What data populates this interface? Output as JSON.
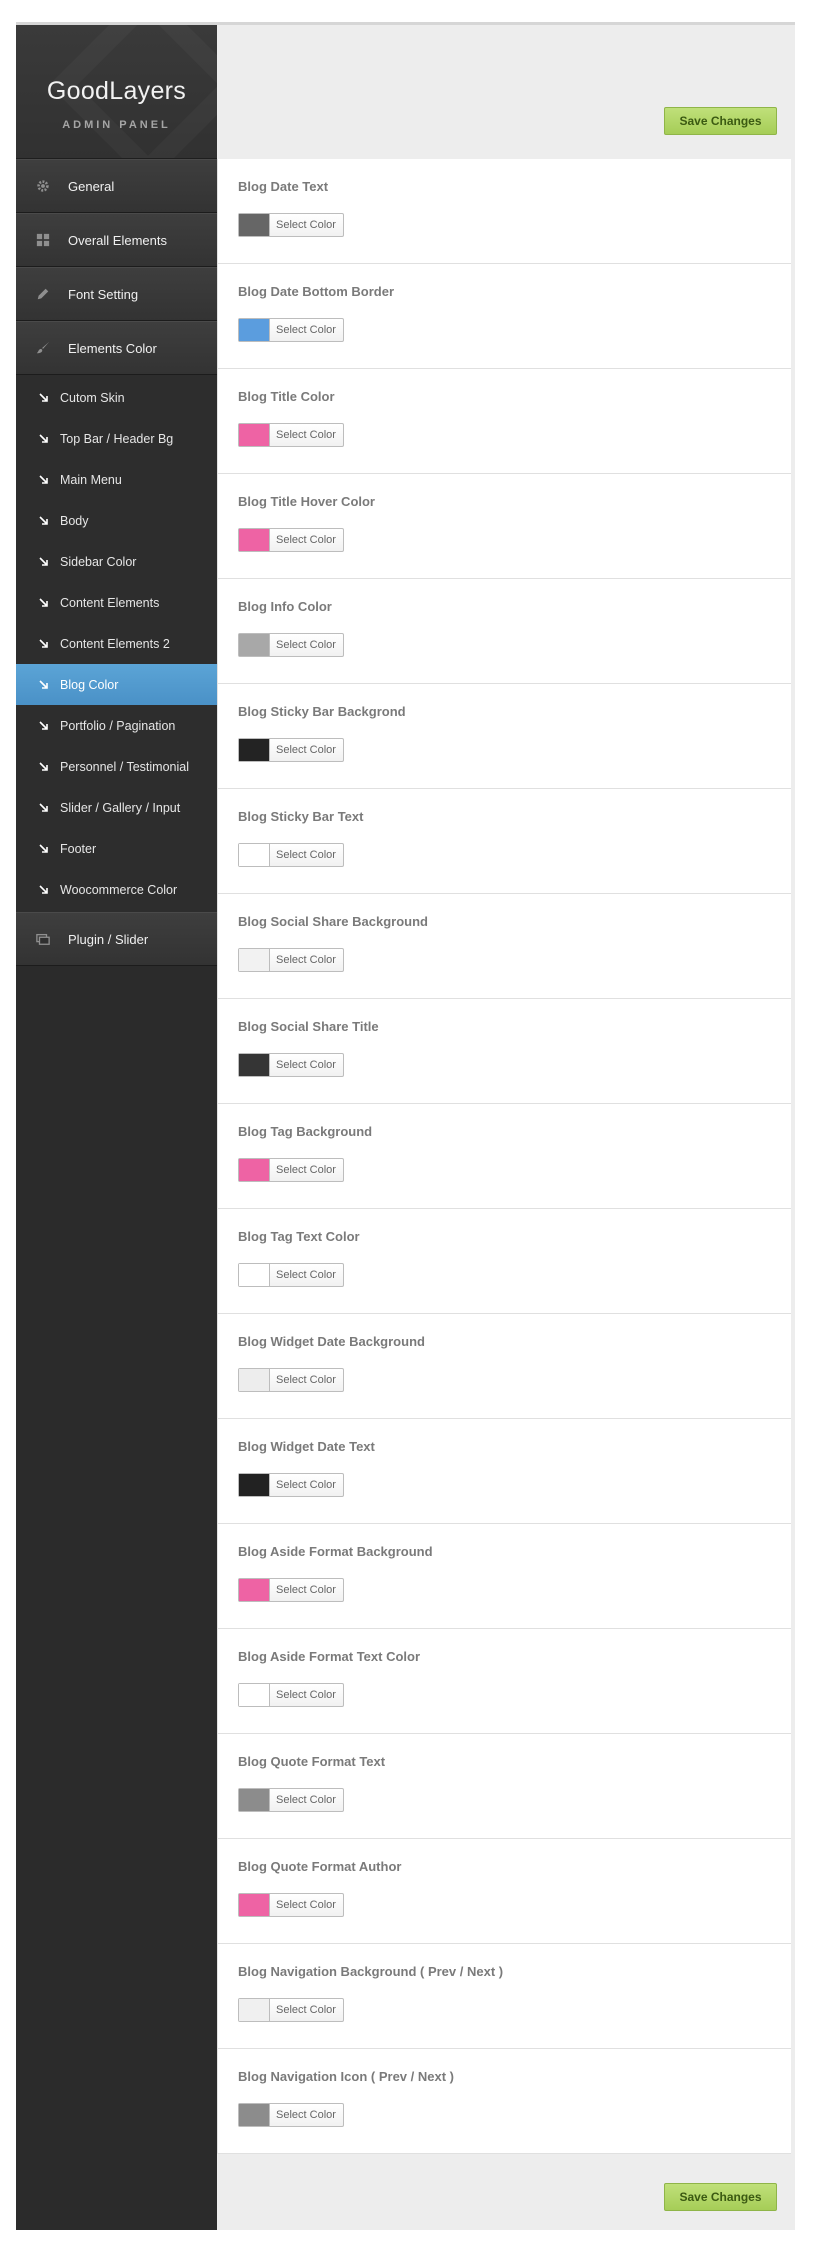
{
  "brand": {
    "title": "GoodLayers",
    "subtitle": "ADMIN PANEL"
  },
  "actions": {
    "save_label": "Save Changes"
  },
  "menu": {
    "top_items": [
      {
        "label": "General",
        "icon": "gear-icon"
      },
      {
        "label": "Overall Elements",
        "icon": "grid-icon"
      },
      {
        "label": "Font Setting",
        "icon": "pencil-icon"
      },
      {
        "label": "Elements Color",
        "icon": "brush-icon"
      }
    ],
    "sub_items": [
      {
        "label": "Cutom Skin"
      },
      {
        "label": "Top Bar / Header Bg"
      },
      {
        "label": "Main Menu"
      },
      {
        "label": "Body"
      },
      {
        "label": "Sidebar Color"
      },
      {
        "label": "Content Elements"
      },
      {
        "label": "Content Elements 2"
      },
      {
        "label": "Blog Color",
        "active": true
      },
      {
        "label": "Portfolio / Pagination"
      },
      {
        "label": "Personnel / Testimonial"
      },
      {
        "label": "Slider / Gallery / Input"
      },
      {
        "label": "Footer"
      },
      {
        "label": "Woocommerce Color"
      }
    ],
    "bottom_items": [
      {
        "label": "Plugin / Slider",
        "icon": "slider-icon"
      }
    ]
  },
  "picker_label": "Select Color",
  "options": [
    {
      "label": "Blog Date Text",
      "color": "#666666"
    },
    {
      "label": "Blog Date Bottom Border",
      "color": "#5b9dde"
    },
    {
      "label": "Blog Title Color",
      "color": "#ee63a4"
    },
    {
      "label": "Blog Title Hover Color",
      "color": "#ee63a4"
    },
    {
      "label": "Blog Info Color",
      "color": "#a8a8a8"
    },
    {
      "label": "Blog Sticky Bar Backgrond",
      "color": "#232323"
    },
    {
      "label": "Blog Sticky Bar Text",
      "color": "#ffffff"
    },
    {
      "label": "Blog Social Share Background",
      "color": "#f2f2f2"
    },
    {
      "label": "Blog Social Share Title",
      "color": "#353535"
    },
    {
      "label": "Blog Tag Background",
      "color": "#ee63a4"
    },
    {
      "label": "Blog Tag Text Color",
      "color": "#ffffff"
    },
    {
      "label": "Blog Widget Date Background",
      "color": "#ededed"
    },
    {
      "label": "Blog Widget Date Text",
      "color": "#222222"
    },
    {
      "label": "Blog Aside Format Background",
      "color": "#ee63a4"
    },
    {
      "label": "Blog Aside Format Text Color",
      "color": "#ffffff"
    },
    {
      "label": "Blog Quote Format Text",
      "color": "#8c8c8c"
    },
    {
      "label": "Blog Quote Format Author",
      "color": "#ee63a4"
    },
    {
      "label": "Blog Navigation Background ( Prev / Next )",
      "color": "#f0f0f0"
    },
    {
      "label": "Blog Navigation Icon ( Prev / Next )",
      "color": "#8c8c8c"
    }
  ]
}
